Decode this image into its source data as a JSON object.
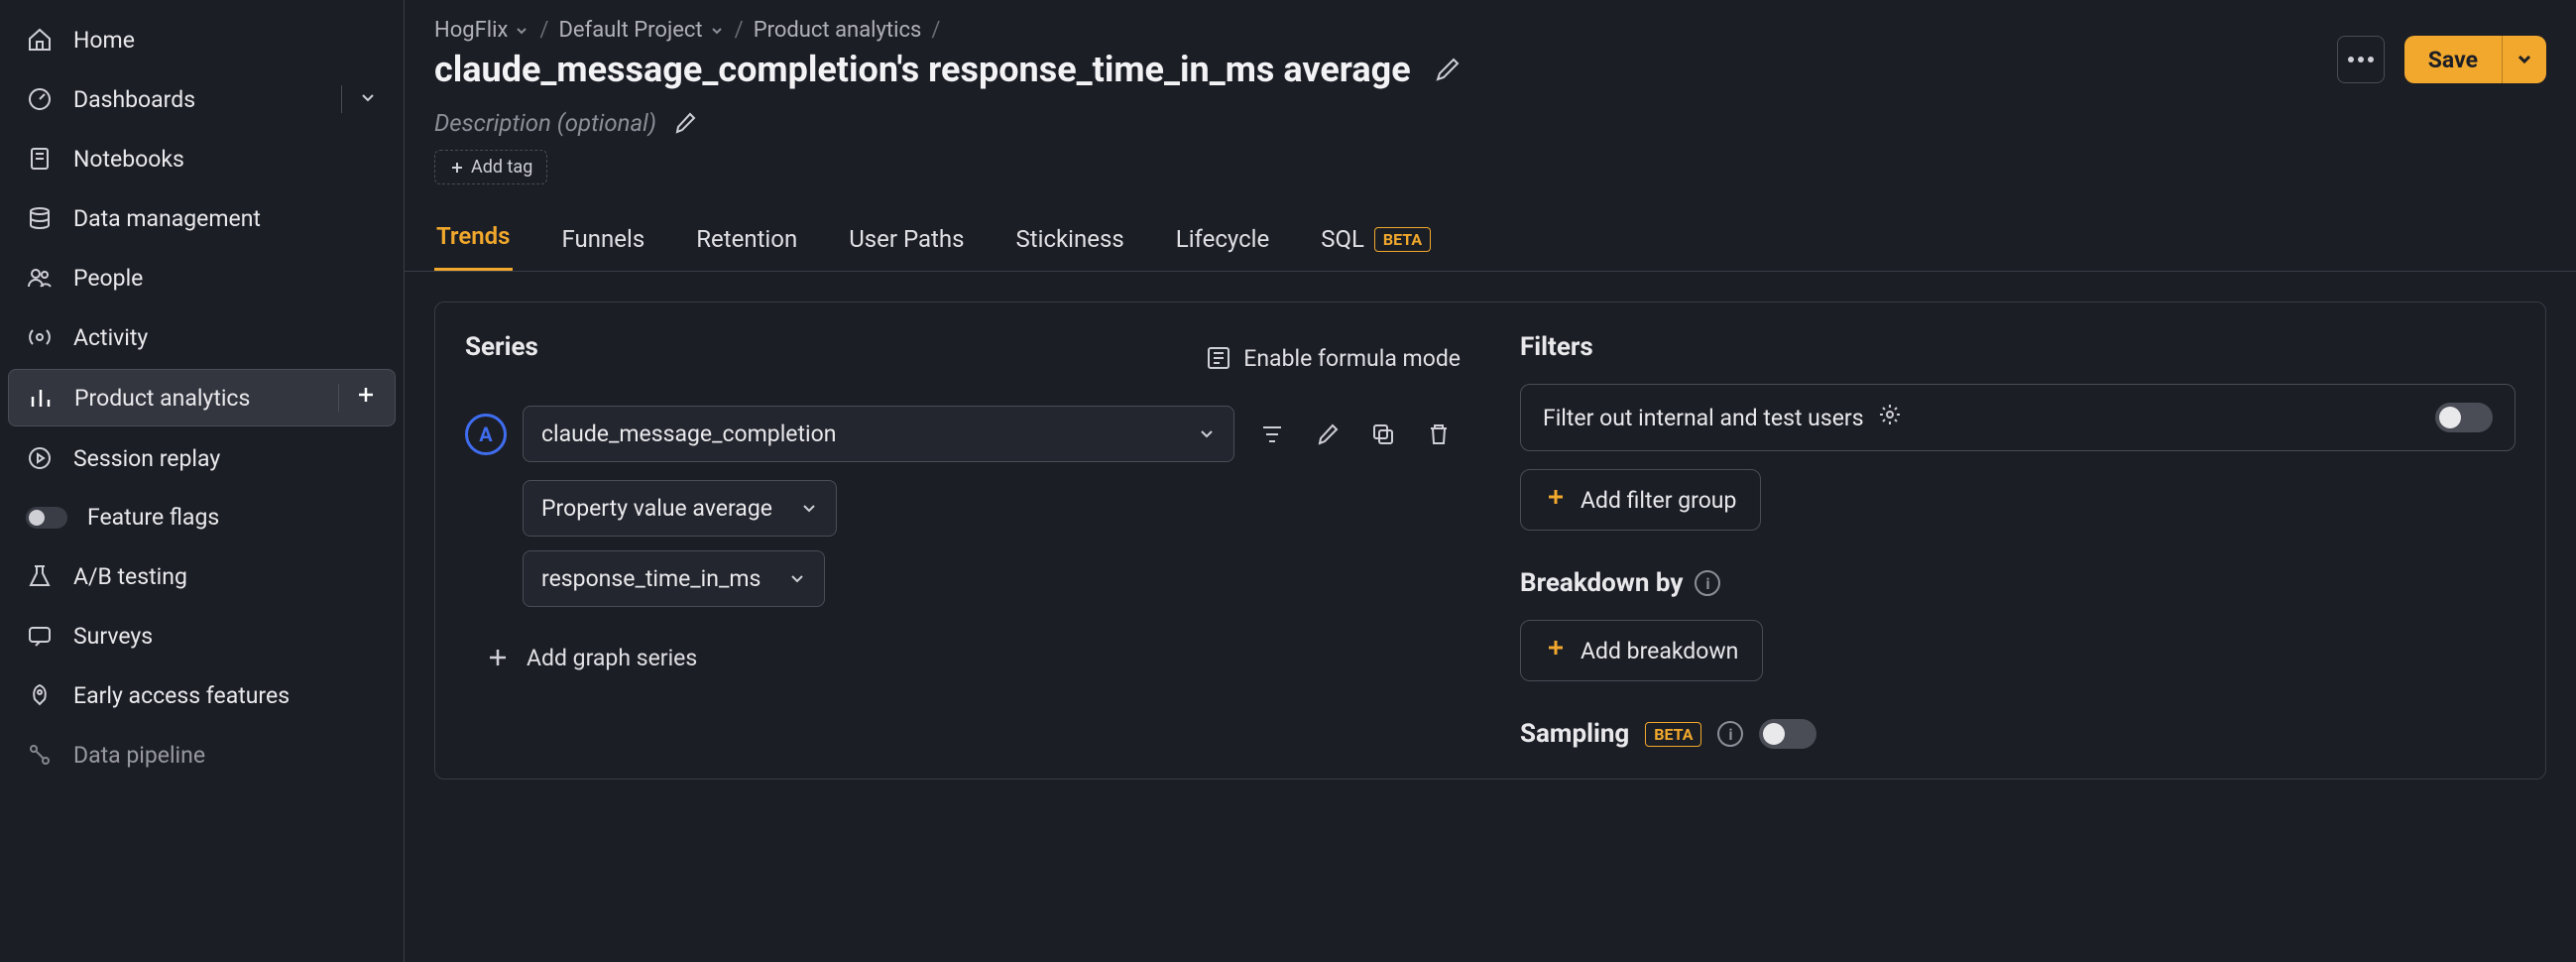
{
  "sidebar": {
    "items": [
      {
        "label": "Home"
      },
      {
        "label": "Dashboards"
      },
      {
        "label": "Notebooks"
      },
      {
        "label": "Data management"
      },
      {
        "label": "People"
      },
      {
        "label": "Activity"
      },
      {
        "label": "Product analytics"
      },
      {
        "label": "Session replay"
      },
      {
        "label": "Feature flags"
      },
      {
        "label": "A/B testing"
      },
      {
        "label": "Surveys"
      },
      {
        "label": "Early access features"
      },
      {
        "label": "Data pipeline"
      }
    ]
  },
  "breadcrumb": {
    "org": "HogFlix",
    "project": "Default Project",
    "section": "Product analytics"
  },
  "page_title": "claude_message_completion's response_time_in_ms average",
  "description_placeholder": "Description (optional)",
  "add_tag_label": "Add tag",
  "save_label": "Save",
  "tabs": [
    {
      "label": "Trends"
    },
    {
      "label": "Funnels"
    },
    {
      "label": "Retention"
    },
    {
      "label": "User Paths"
    },
    {
      "label": "Stickiness"
    },
    {
      "label": "Lifecycle"
    },
    {
      "label": "SQL",
      "badge": "BETA"
    }
  ],
  "series": {
    "title": "Series",
    "formula_btn": "Enable formula mode",
    "letter": "A",
    "event": "claude_message_completion",
    "agg": "Property value average",
    "prop": "response_time_in_ms",
    "add_series": "Add graph series"
  },
  "filters": {
    "title": "Filters",
    "internal_test": "Filter out internal and test users",
    "add_group": "Add filter group"
  },
  "breakdown": {
    "title": "Breakdown by",
    "add": "Add breakdown"
  },
  "sampling": {
    "title": "Sampling",
    "badge": "BETA"
  }
}
